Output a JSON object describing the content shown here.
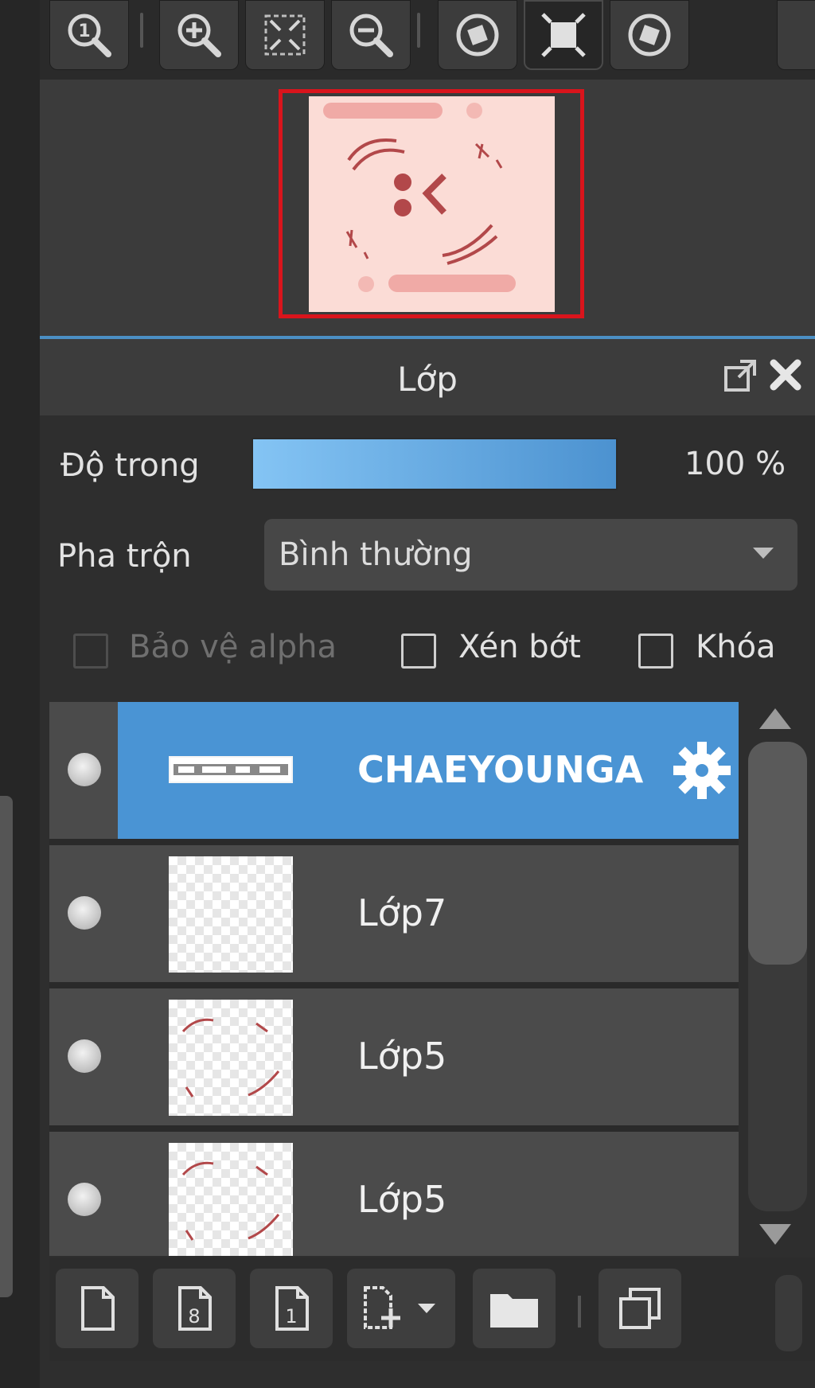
{
  "toolbar": {
    "buttons": [
      {
        "name": "zoom-actual-size-button",
        "icon": "zoom-1-icon"
      },
      {
        "name": "zoom-in-button",
        "icon": "zoom-in-icon"
      },
      {
        "name": "fit-to-window-button",
        "icon": "fit-screen-icon"
      },
      {
        "name": "zoom-out-button",
        "icon": "zoom-out-icon"
      },
      {
        "name": "rotate-left-button",
        "icon": "rotate-left-icon"
      },
      {
        "name": "reset-rotation-button",
        "icon": "reset-view-icon"
      },
      {
        "name": "rotate-right-button",
        "icon": "rotate-right-icon"
      }
    ]
  },
  "layer_panel": {
    "title": "Lớp",
    "opacity_label": "Độ trong",
    "opacity_value": "100 %",
    "opacity_percent": 100,
    "blend_label": "Pha trộn",
    "blend_value": "Bình thường",
    "checkboxes": {
      "alpha": {
        "label": "Bảo vệ alpha",
        "checked": false,
        "enabled": false
      },
      "clip": {
        "label": "Xén bớt",
        "checked": false,
        "enabled": true
      },
      "lock": {
        "label": "Khóa",
        "checked": false,
        "enabled": true
      }
    },
    "layers": [
      {
        "name": "CHAEYOUNGA",
        "selected": true,
        "thumbnail": "text"
      },
      {
        "name": "Lớp7",
        "selected": false,
        "thumbnail": "empty"
      },
      {
        "name": "Lớp5",
        "selected": false,
        "thumbnail": "sparkles"
      },
      {
        "name": "Lớp5",
        "selected": false,
        "thumbnail": "sparkles"
      }
    ]
  },
  "bottom_bar": {
    "buttons": [
      {
        "name": "new-layer-button",
        "icon": "new-page-icon"
      },
      {
        "name": "new-8bit-layer-button",
        "icon": "page-8-icon"
      },
      {
        "name": "new-1bit-layer-button",
        "icon": "page-1-icon"
      },
      {
        "name": "add-layer-menu-button",
        "icon": "add-page-dropdown-icon"
      },
      {
        "name": "new-folder-button",
        "icon": "folder-icon"
      },
      {
        "name": "duplicate-layer-button",
        "icon": "duplicate-icon"
      }
    ]
  },
  "colors": {
    "selection": "#4a94d4",
    "accent_divider": "#4b8fc4",
    "navigator_frame": "#d9141c",
    "canvas_pink": "#fbdcd6",
    "sketch": "#b2484a"
  }
}
